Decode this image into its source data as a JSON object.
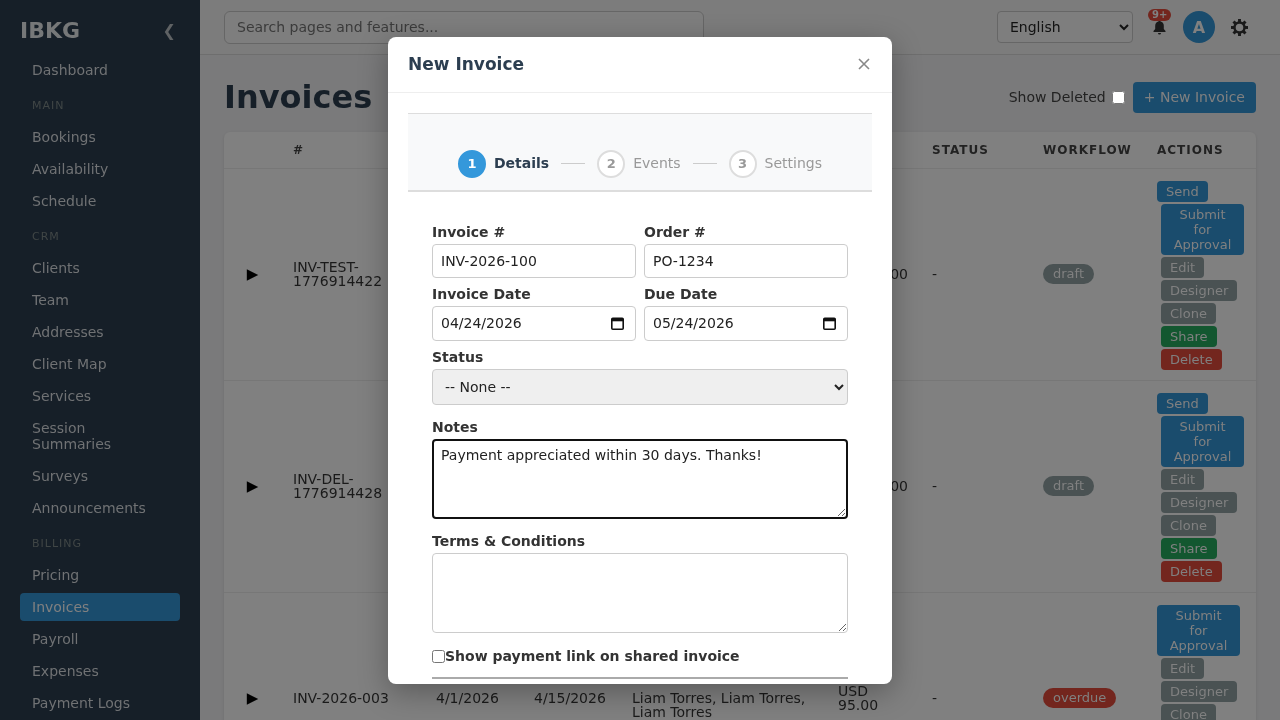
{
  "sidebar": {
    "logo": "IBKG",
    "collapse_toggle": "❮",
    "top_items": [
      {
        "label": "Dashboard",
        "selected": false
      }
    ],
    "sections": [
      {
        "heading": "MAIN",
        "items": [
          {
            "label": "Bookings",
            "selected": false
          },
          {
            "label": "Availability",
            "selected": false
          },
          {
            "label": "Schedule",
            "selected": false
          }
        ]
      },
      {
        "heading": "CRM",
        "items": [
          {
            "label": "Clients",
            "selected": false
          },
          {
            "label": "Team",
            "selected": false
          },
          {
            "label": "Addresses",
            "selected": false
          },
          {
            "label": "Client Map",
            "selected": false
          },
          {
            "label": "Services",
            "selected": false
          },
          {
            "label": "Session Summaries",
            "selected": false
          },
          {
            "label": "Surveys",
            "selected": false
          },
          {
            "label": "Announcements",
            "selected": false
          }
        ]
      },
      {
        "heading": "BILLING",
        "items": [
          {
            "label": "Pricing",
            "selected": false
          },
          {
            "label": "Invoices",
            "selected": true
          },
          {
            "label": "Payroll",
            "selected": false
          },
          {
            "label": "Expenses",
            "selected": false
          },
          {
            "label": "Payment Logs",
            "selected": false
          }
        ]
      }
    ]
  },
  "topbar": {
    "search": {
      "placeholder": "Search pages and features..."
    },
    "language": "English",
    "notifications": {
      "badge": "9+"
    },
    "avatar": {
      "initial": "A"
    }
  },
  "page": {
    "title": "Invoices",
    "show_deleted": {
      "label": "Show Deleted",
      "checked": false
    },
    "new_button": "+ New Invoice"
  },
  "table": {
    "headers": {
      "number": "#",
      "status": "STATUS",
      "workflow": "WORKFLOW",
      "actions": "ACTIONS"
    },
    "rows": [
      {
        "expander": "▶",
        "number": "INV-TEST-1776914422",
        "amount": "00",
        "status": "-",
        "workflow": {
          "label": "draft",
          "color": "#4a5253"
        },
        "actions": [
          {
            "label": "Send",
            "kind": "primary"
          },
          {
            "label": "Submit for Approval",
            "kind": "primary"
          },
          {
            "label": "Edit",
            "kind": "secondary"
          },
          {
            "label": "Designer",
            "kind": "secondary"
          },
          {
            "label": "Clone",
            "kind": "secondary"
          },
          {
            "label": "Share",
            "kind": "success"
          },
          {
            "label": "Delete",
            "kind": "danger"
          }
        ]
      },
      {
        "expander": "▶",
        "number": "INV-DEL-1776914428",
        "amount": "00",
        "status": "-",
        "workflow": {
          "label": "draft",
          "color": "#4a5253"
        },
        "actions": [
          {
            "label": "Send",
            "kind": "primary"
          },
          {
            "label": "Submit for Approval",
            "kind": "primary"
          },
          {
            "label": "Edit",
            "kind": "secondary"
          },
          {
            "label": "Designer",
            "kind": "secondary"
          },
          {
            "label": "Clone",
            "kind": "secondary"
          },
          {
            "label": "Share",
            "kind": "success"
          },
          {
            "label": "Delete",
            "kind": "danger"
          }
        ]
      },
      {
        "expander": "▶",
        "number": "INV-2026-003",
        "date": "4/1/2026",
        "due_date": "4/15/2026",
        "client": "Liam Torres, Liam Torres, Liam Torres",
        "amount": "USD 95.00",
        "status": "-",
        "workflow": {
          "label": "overdue",
          "color": "#73261e"
        },
        "actions": [
          {
            "label": "Submit for Approval",
            "kind": "primary"
          },
          {
            "label": "Edit",
            "kind": "secondary"
          },
          {
            "label": "Designer",
            "kind": "secondary"
          },
          {
            "label": "Clone",
            "kind": "secondary"
          }
        ]
      }
    ]
  },
  "modal": {
    "title": "New Invoice",
    "steps": [
      {
        "number": "1",
        "label": "Details",
        "selected": true
      },
      {
        "number": "2",
        "label": "Events",
        "selected": false
      },
      {
        "number": "3",
        "label": "Settings",
        "selected": false
      }
    ],
    "fields": [
      {
        "kind": "text",
        "label": "Invoice #",
        "value": "INV-2026-100"
      },
      {
        "kind": "text",
        "label": "Order #",
        "value": "PO-1234"
      },
      {
        "kind": "date",
        "label": "Invoice Date",
        "value": "04/24/2026"
      },
      {
        "kind": "date",
        "label": "Due Date",
        "value": "05/24/2026"
      },
      {
        "kind": "select",
        "label": "Status",
        "value": "-- None --"
      },
      {
        "kind": "textarea",
        "label": "Notes",
        "value": "Payment appreciated within 30 days. Thanks!",
        "focused": true
      },
      {
        "kind": "textarea",
        "label": "Terms & Conditions",
        "focused": false
      }
    ],
    "payment_link": {
      "label": "Show payment link on shared invoice",
      "checked": false
    }
  }
}
